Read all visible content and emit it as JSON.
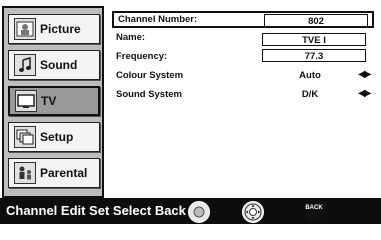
{
  "sidebar": {
    "items": [
      {
        "label": "Picture",
        "icon": "picture-icon",
        "selected": false
      },
      {
        "label": "Sound",
        "icon": "music-note-icon",
        "selected": false
      },
      {
        "label": "TV",
        "icon": "tv-icon",
        "selected": true
      },
      {
        "label": "Setup",
        "icon": "setup-icon",
        "selected": false
      },
      {
        "label": "Parental",
        "icon": "parental-icon",
        "selected": false
      }
    ]
  },
  "content": {
    "channel_number_label": "Channel Number:",
    "channel_number_value": "802",
    "name_label": "Name:",
    "name_value": "TVE I",
    "frequency_label": "Frequency:",
    "frequency_value": "77.3",
    "colour_system_label": "Colour System",
    "colour_system_value": "Auto",
    "sound_system_label": "Sound System",
    "sound_system_value": "D/K"
  },
  "bottom_bar": {
    "text": "Channel Edit Set Select Back",
    "back_button_label": "BACK"
  },
  "colors": {
    "sidebar_bg": "#bdbdbd",
    "selected_item_bg": "#9a9a9a",
    "bottom_bar_bg": "#0d0d0d"
  }
}
